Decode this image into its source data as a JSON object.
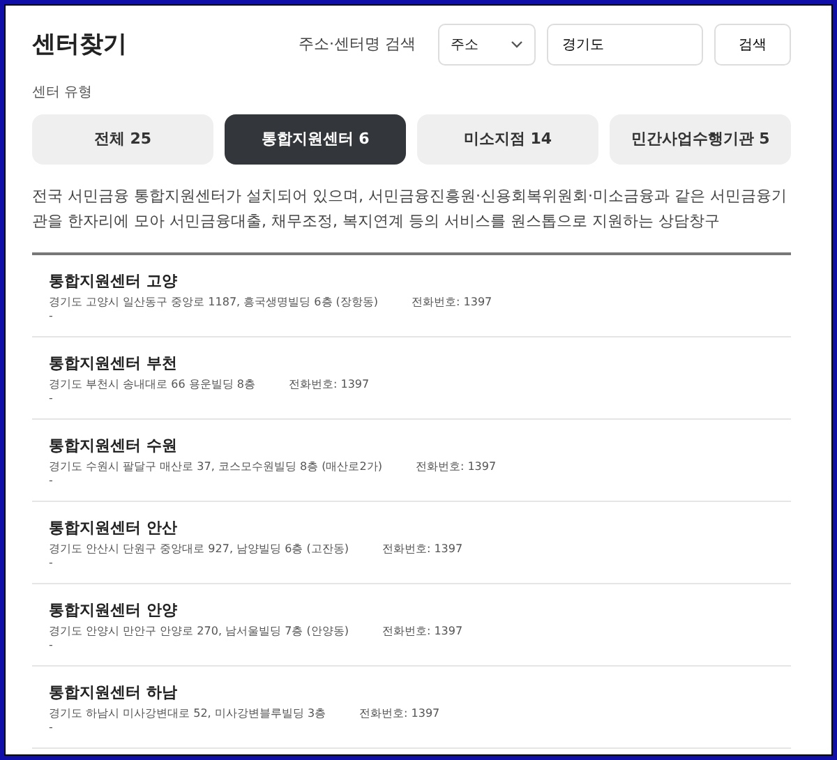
{
  "title": "센터찾기",
  "search": {
    "label": "주소·센터명 검색",
    "select": "주소",
    "value": "경기도",
    "button": "검색"
  },
  "type_label": "센터 유형",
  "tabs": [
    {
      "label": "전체 25",
      "selected": false
    },
    {
      "label": "통합지원센터 6",
      "selected": true
    },
    {
      "label": "미소지점 14",
      "selected": false
    },
    {
      "label": "민간사업수행기관 5",
      "selected": false
    }
  ],
  "description": "전국 서민금융 통합지원센터가 설치되어 있으며, 서민금융진흥원·신용회복위원회·미소금융과 같은 서민금융기관을 한자리에 모아 서민금융대출, 채무조정, 복지연계 등의 서비스를 원스톱으로 지원하는 상담창구",
  "centers": [
    {
      "name": "통합지원센터 고양",
      "address": "경기도 고양시 일산동구 중앙로 1187, 흥국생명빌딩 6층 (장항동)",
      "phone": "전화번호: 1397",
      "note": "-"
    },
    {
      "name": "통합지원센터 부천",
      "address": "경기도 부천시 송내대로 66 용운빌딩 8층",
      "phone": "전화번호: 1397",
      "note": "-"
    },
    {
      "name": "통합지원센터 수원",
      "address": "경기도 수원시 팔달구 매산로 37, 코스모수원빌딩 8층 (매산로2가)",
      "phone": "전화번호: 1397",
      "note": "-"
    },
    {
      "name": "통합지원센터 안산",
      "address": "경기도 안산시 단원구 중앙대로 927, 남양빌딩 6층 (고잔동)",
      "phone": "전화번호: 1397",
      "note": "-"
    },
    {
      "name": "통합지원센터 안양",
      "address": "경기도 안양시 만안구 안양로 270, 남서울빌딩 7층 (안양동)",
      "phone": "전화번호: 1397",
      "note": "-"
    },
    {
      "name": "통합지원센터 하남",
      "address": "경기도 하남시 미사강변대로 52, 미사강변블루빌딩 3층",
      "phone": "전화번호: 1397",
      "note": "-"
    }
  ]
}
